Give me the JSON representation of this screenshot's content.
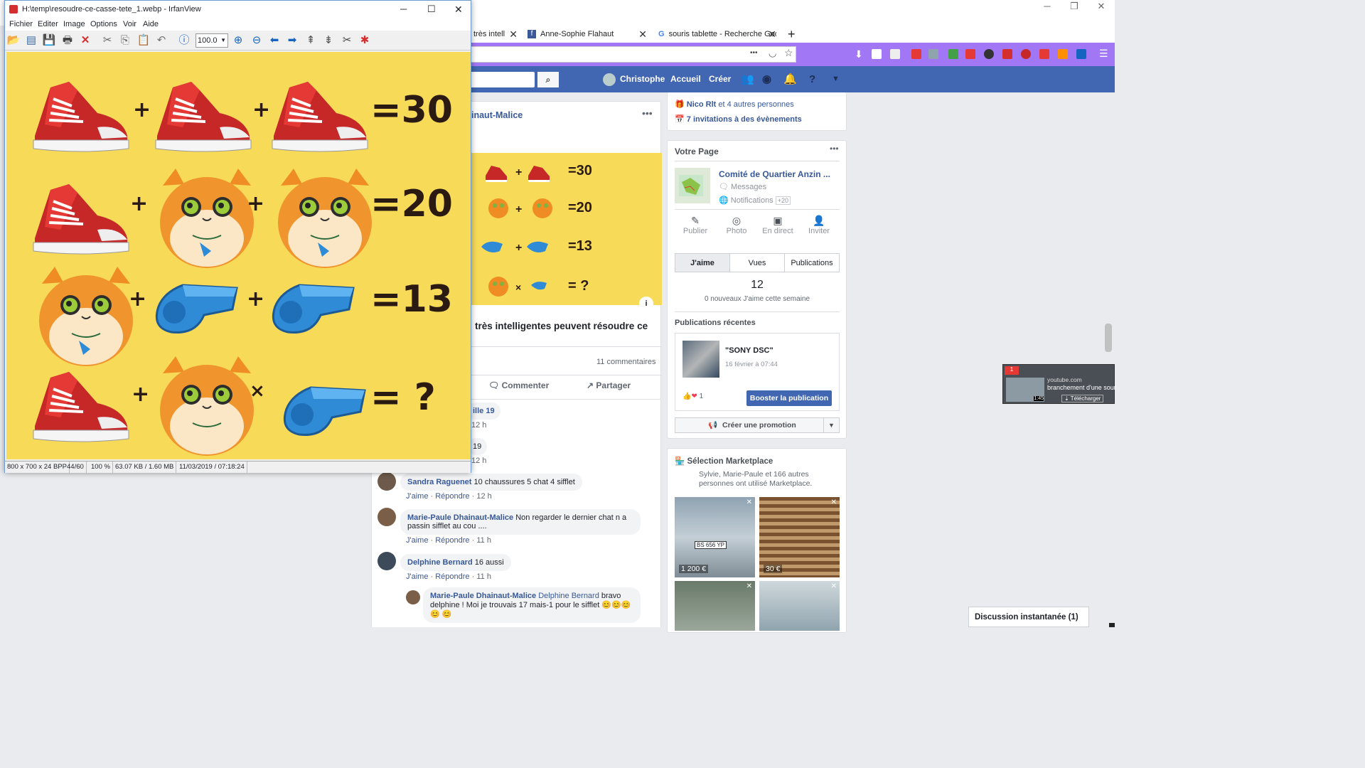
{
  "firefox": {
    "tabs": [
      {
        "label": "très intell",
        "close": "✕"
      },
      {
        "label": "Anne-Sophie Flahaut",
        "close": "✕"
      },
      {
        "label": "souris tablette - Recherche Goo",
        "close": "✕"
      }
    ],
    "new_tab": "+",
    "ellipsis": "•••"
  },
  "facebook": {
    "user": "Christophe",
    "nav": [
      "Accueil",
      "Créer"
    ],
    "post_author": "inaut-Malice",
    "post_title": "très intelligentes peuvent résoudre ce",
    "comments_count": "11 commentaires",
    "actions": [
      "Commenter",
      "Partager"
    ],
    "mini_values": [
      "=30",
      "=20",
      "=13",
      "= ?"
    ],
    "comments": [
      {
        "frag": "ille 19",
        "time": "12 h"
      },
      {
        "frag": "19",
        "time": "12 h"
      },
      {
        "author": "Sandra Raguenet",
        "text": "10 chaussures 5 chat 4 sifflet",
        "like": "J'aime",
        "reply": "Répondre",
        "time": "12 h"
      },
      {
        "author": "Marie-Paule Dhainaut-Malice",
        "text": "Non regarder le dernier chat n a passin sifflet au cou ....",
        "like": "J'aime",
        "reply": "Répondre",
        "time": "11 h"
      },
      {
        "author": "Delphine Bernard",
        "text": "16 aussi",
        "like": "J'aime",
        "reply": "Répondre",
        "time": "11 h"
      },
      {
        "author": "Marie-Paule Dhainaut-Malice",
        "mention": "Delphine Bernard",
        "text": "bravo delphine ! Moi je trouvais 17 mais-1 pour le sifflet 😊😊😊😊 😊"
      }
    ],
    "right": {
      "friends_line": "Nico Rlt",
      "friends_rest": "et 4 autres personnes",
      "invites": "7 invitations à des évènements",
      "page_header": "Votre Page",
      "page_name": "Comité de Quartier Anzin ...",
      "messages": "Messages",
      "notifications": "Notifications",
      "notif_badge": "+20",
      "page_actions": [
        "Publier",
        "Photo",
        "En direct",
        "Inviter"
      ],
      "tabs": [
        "J'aime",
        "Vues",
        "Publications"
      ],
      "likes_count": "12",
      "likes_sub": "0 nouveaux J'aime cette semaine",
      "recent_header": "Publications récentes",
      "recent_title": "\"SONY DSC\"",
      "recent_date": "16 février à 07:44",
      "reactions": "1",
      "boost": "Booster la publication",
      "promo": "Créer une promotion",
      "marketplace_header": "Sélection Marketplace",
      "marketplace_sub": "Sylvie, Marie-Paule et 166 autres personnes ont utilisé Marketplace.",
      "prices": [
        "1 200 €",
        "30 €"
      ],
      "plate": "BS 656 YP"
    },
    "chat": "Discussion instantanée (1)"
  },
  "youtube_popup": {
    "site": "youtube.com",
    "title": "branchement d'une sour",
    "button": "Télécharger",
    "count": "1",
    "duration": "1:45"
  },
  "irfanview": {
    "title": "H:\\temp\\resoudre-ce-casse-tete_1.webp - IrfanView",
    "menu": [
      "Fichier",
      "Editer",
      "Image",
      "Options",
      "Voir",
      "Aide"
    ],
    "zoom": "100.0",
    "status": [
      "800 x 700 x 24 BPP",
      "44/60",
      "100 %",
      "63.07 KB / 1.60 MB",
      "11/03/2019 / 07:18:24"
    ]
  },
  "puzzle": {
    "rows": [
      {
        "items": [
          "shoe",
          "shoe",
          "shoe"
        ],
        "ops": [
          "+",
          "+"
        ],
        "result": "=30"
      },
      {
        "items": [
          "shoe",
          "cat",
          "cat"
        ],
        "ops": [
          "+",
          "+"
        ],
        "result": "=20"
      },
      {
        "items": [
          "cat",
          "whistle",
          "whistle"
        ],
        "ops": [
          "+",
          "+"
        ],
        "result": "=13"
      },
      {
        "items": [
          "shoe",
          "cat",
          "whistle"
        ],
        "ops": [
          "+",
          "×"
        ],
        "result": "= ?"
      }
    ]
  }
}
